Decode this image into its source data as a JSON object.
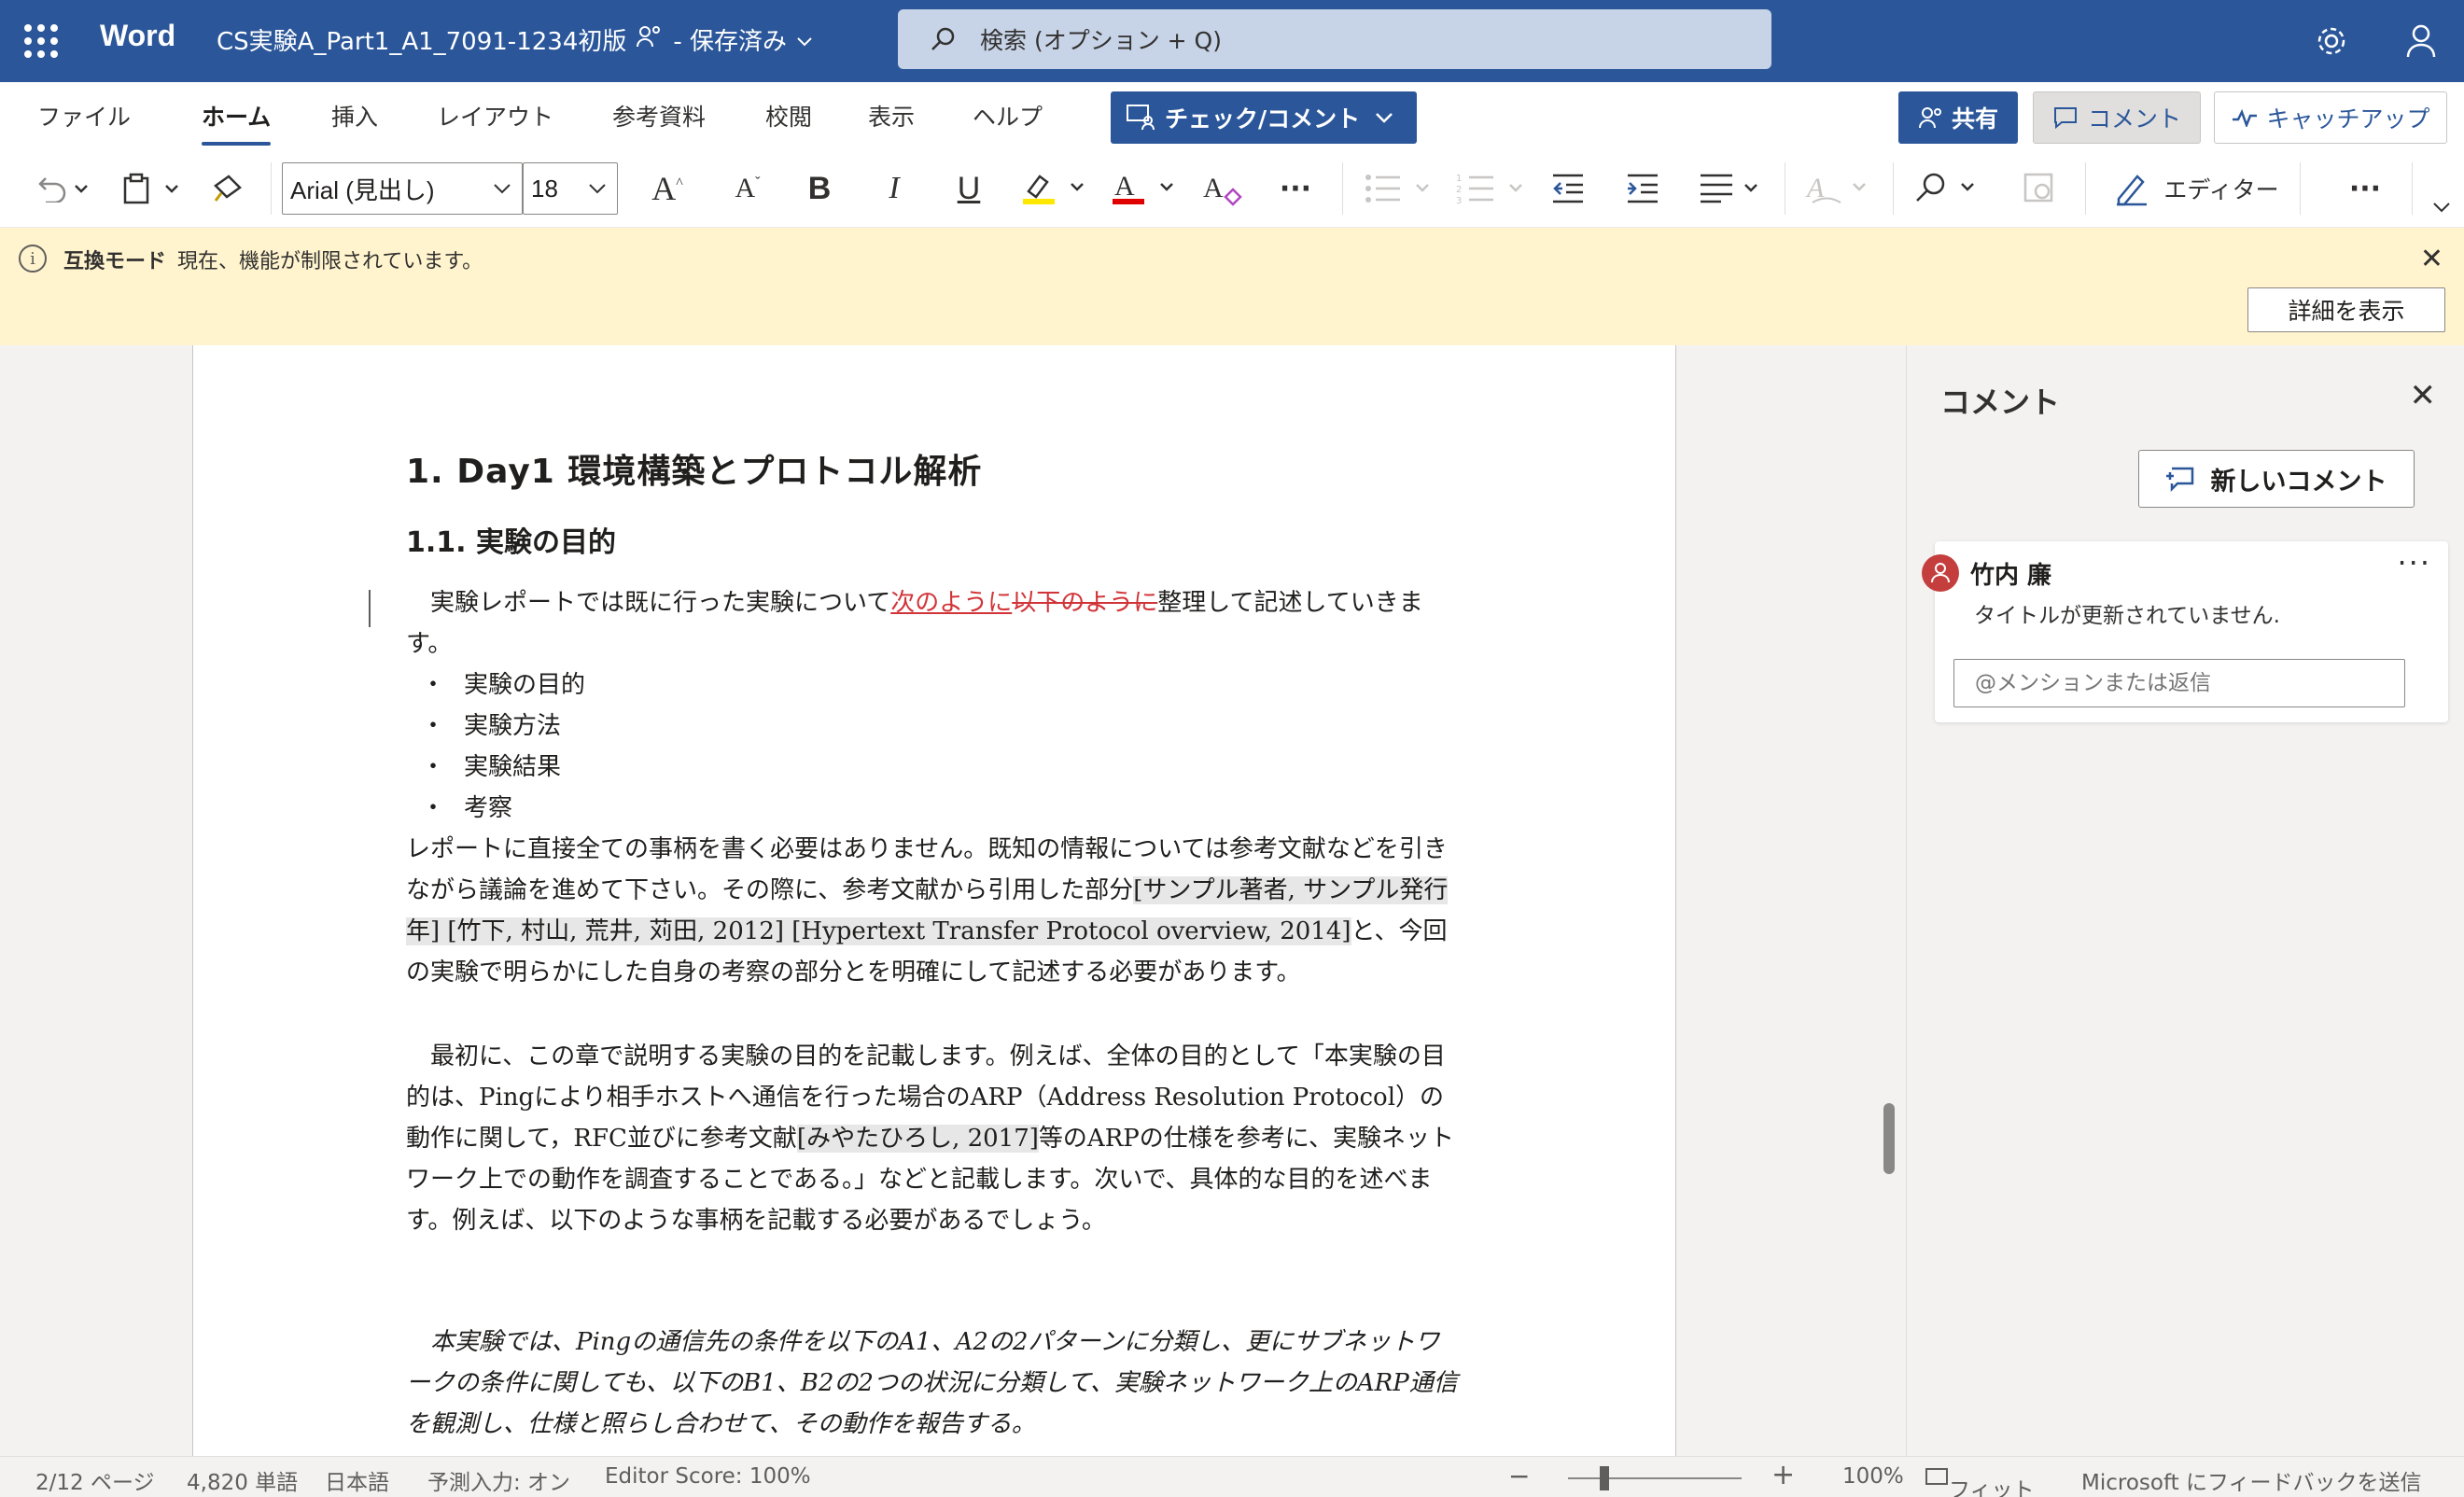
{
  "titlebar": {
    "app_name": "Word",
    "doc_title": "CS実験A_Part1_A1_7091-1234初版",
    "save_status": "- 保存済み",
    "search_placeholder": "検索 (オプション + Q)"
  },
  "tabs": [
    "ファイル",
    "ホーム",
    "挿入",
    "レイアウト",
    "参考資料",
    "校閲",
    "表示",
    "ヘルプ"
  ],
  "active_tab": "ホーム",
  "ribbon_right": {
    "check_comment": "チェック/コメント",
    "share": "共有",
    "comment": "コメント",
    "catch_up": "キャッチアップ"
  },
  "toolbar": {
    "font_name": "Arial (見出し)",
    "font_size": "18",
    "bold": "B",
    "italic": "I",
    "underline": "U",
    "editor": "エディター",
    "more": "···"
  },
  "banner": {
    "title": "互換モード",
    "message": "現在、機能が制限されています。",
    "details_button": "詳細を表示",
    "bg_color": "#fff4ce"
  },
  "document": {
    "heading1": "1.  Day1 環境構築とプロトコル解析",
    "heading2": "1.1.   実験の目的",
    "p1_before": "　実験レポートでは既に行った実験について",
    "p1_inserted": "次のように",
    "p1_deleted": "以下のように",
    "p1_after": "整理して記述していきます。",
    "bullets": [
      "実験の目的",
      "実験方法",
      "実験結果",
      "考察"
    ],
    "p2_before": "レポートに直接全ての事柄を書く必要はありません。既知の情報については参考文献などを引きながら議論を進めて下さい。その際に、参考文献から引用した部分",
    "p2_cite": "[サンプル著者, サンプル発行年] [竹下, 村山, 荒井, 苅田, 2012] [Hypertext Transfer Protocol overview, 2014]",
    "p2_after": "と、今回の実験で明らかにした自身の考察の部分とを明確にして記述する必要があります。",
    "p3_before": "　最初に、この章で説明する実験の目的を記載します。例えば、全体の目的として「本実験の目的は、Pingにより相手ホストへ通信を行った場合のARP（Address Resolution Protocol）の動作に関して，RFC並びに参考文献",
    "p3_cite": "[みやたひろし, 2017]",
    "p3_after": "等のARPの仕様を参考に、実験ネットワーク上での動作を調査することである。」などと記載します。次いで、具体的な目的を述べます。例えば、以下のような事柄を記載する必要があるでしょう。",
    "p4": "　本実験では、Pingの通信先の条件を以下のA1、A2の2パターンに分類し、更にサブネットワークの条件に関しても、以下のB1、B2の2つの状況に分類して、実験ネットワーク上のARP通信を観測し、仕様と照らし合わせて、その動作を報告する。"
  },
  "comments_pane": {
    "title": "コメント",
    "new_comment": "新しいコメント",
    "comment": {
      "author": "竹内 廉",
      "text": "タイトルが更新されていません.",
      "reply_placeholder": "@メンションまたは返信"
    }
  },
  "status_bar": {
    "page": "2/12 ページ",
    "words": "4,820 単語",
    "language": "日本語",
    "predictive": "予測入力: オン",
    "editor_score": "Editor Score: 100%",
    "zoom_minus": "−",
    "zoom_plus": "+",
    "zoom": "100%",
    "fit": "フィット",
    "feedback": "Microsoft にフィードバックを送信"
  },
  "colors": {
    "brand": "#2b579a",
    "tracked_change": "#d13438",
    "avatar": "#c43e3e"
  }
}
